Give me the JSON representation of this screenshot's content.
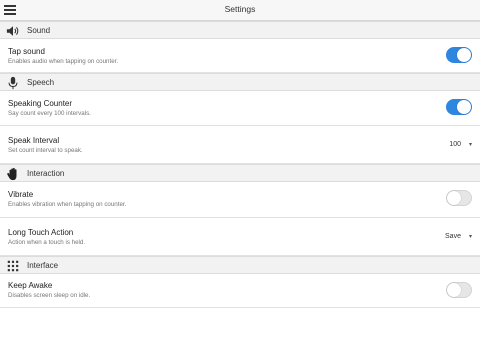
{
  "header": {
    "title": "Settings",
    "menu_icon": "hamburger-menu-icon"
  },
  "sections": {
    "sound": {
      "label": "Sound",
      "icon": "speaker-icon"
    },
    "speech": {
      "label": "Speech",
      "icon": "microphone-icon"
    },
    "interaction": {
      "label": "Interaction",
      "icon": "hand-icon"
    },
    "interface": {
      "label": "Interface",
      "icon": "grid-icon"
    }
  },
  "rows": {
    "tap_sound": {
      "title": "Tap sound",
      "desc": "Enables audio when tapping on counter.",
      "on": true
    },
    "speaking_counter": {
      "title": "Speaking Counter",
      "desc": "Say count every 100 intervals.",
      "on": true
    },
    "speak_interval": {
      "title": "Speak Interval",
      "desc": "Set count interval to speak.",
      "value": "100"
    },
    "vibrate": {
      "title": "Vibrate",
      "desc": "Enables vibration when tapping on counter.",
      "on": false
    },
    "long_touch": {
      "title": "Long Touch Action",
      "desc": "Action when a touch is held.",
      "value": "Save"
    },
    "keep_awake": {
      "title": "Keep Awake",
      "desc": "Disables screen sleep on idle.",
      "on": false
    }
  },
  "colors": {
    "accent": "#2e86de",
    "section_bg": "#f2f2f2",
    "header_bg": "#f7f7f7"
  }
}
